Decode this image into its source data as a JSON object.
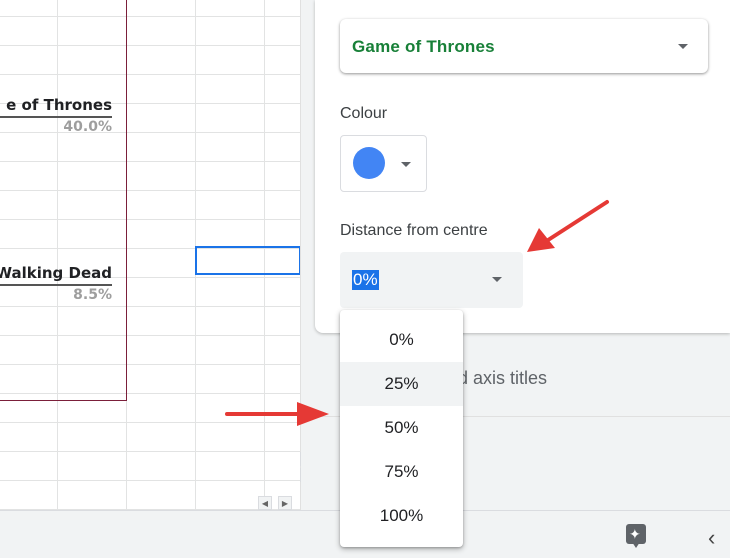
{
  "sheet": {
    "chart_labels": [
      {
        "name": "e of Thrones",
        "percent": "40.0%"
      },
      {
        "name": "Walking Dead",
        "percent": "8.5%"
      }
    ]
  },
  "panel": {
    "series_select": {
      "value": "Game of Thrones"
    },
    "colour": {
      "label": "Colour",
      "value_color": "#4285f4"
    },
    "distance": {
      "label": "Distance from centre",
      "value": "0%"
    },
    "partially_hidden_section": "nd axis titles"
  },
  "dropdown": {
    "options": [
      "0%",
      "25%",
      "50%",
      "75%",
      "100%"
    ],
    "hovered": "25%"
  },
  "colors": {
    "series_text": "#188038",
    "selection_blue": "#1a73e8",
    "annotation_arrow": "#e53935"
  },
  "icons": [
    "chevron-down-icon",
    "explore-icon",
    "chevron-left-icon",
    "scroll-arrow-icon"
  ]
}
